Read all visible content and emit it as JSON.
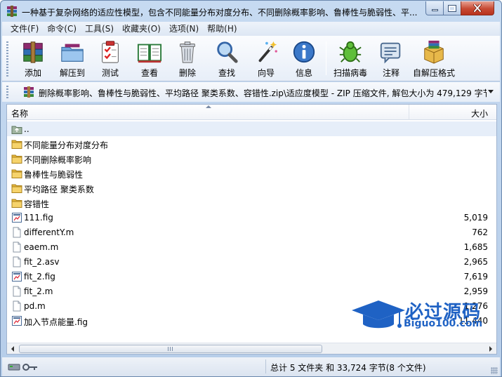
{
  "window": {
    "title": "一种基于复杂网络的适应性模型，包含不同能量分布对度分布、不同删除概率影响、鲁棒性与脆弱性、平..."
  },
  "menu": [
    {
      "label": "文件(F)"
    },
    {
      "label": "命令(C)"
    },
    {
      "label": "工具(S)"
    },
    {
      "label": "收藏夹(O)"
    },
    {
      "label": "选项(N)"
    },
    {
      "label": "帮助(H)"
    }
  ],
  "toolbar": {
    "add": "添加",
    "extract": "解压到",
    "test": "测试",
    "view": "查看",
    "delete": "删除",
    "find": "查找",
    "wizard": "向导",
    "info": "信息",
    "virus_scan": "扫描病毒",
    "comment": "注释",
    "sfx": "自解压格式"
  },
  "address": {
    "path": "删除概率影响、鲁棒性与脆弱性、平均路径 聚类系数、容错性.zip\\适应度模型 - ZIP 压缩文件, 解包大小为 479,129 字节"
  },
  "columns": {
    "name": "名称",
    "size": "大小"
  },
  "files": [
    {
      "name": "..",
      "size": "",
      "icon": "parent-folder-icon"
    },
    {
      "name": "不同能量分布对度分布",
      "size": "",
      "icon": "folder-icon"
    },
    {
      "name": "不同删除概率影响",
      "size": "",
      "icon": "folder-icon"
    },
    {
      "name": "鲁棒性与脆弱性",
      "size": "",
      "icon": "folder-icon"
    },
    {
      "name": "平均路径 聚类系数",
      "size": "",
      "icon": "folder-icon"
    },
    {
      "name": "容错性",
      "size": "",
      "icon": "folder-icon"
    },
    {
      "name": "111.fig",
      "size": "5,019",
      "icon": "fig-file-icon"
    },
    {
      "name": "differentY.m",
      "size": "762",
      "icon": "file-icon"
    },
    {
      "name": "eaem.m",
      "size": "1,685",
      "icon": "file-icon"
    },
    {
      "name": "fit_2.asv",
      "size": "2,965",
      "icon": "file-icon"
    },
    {
      "name": "fit_2.fig",
      "size": "7,619",
      "icon": "fig-file-icon"
    },
    {
      "name": "fit_2.m",
      "size": "2,959",
      "icon": "file-icon"
    },
    {
      "name": "pd.m",
      "size": "1,276",
      "icon": "file-icon"
    },
    {
      "name": "加入节点能量.fig",
      "size": "11,440",
      "icon": "fig-file-icon"
    }
  ],
  "watermark": {
    "brand": "必过源码",
    "url": "Biguo100.com"
  },
  "status": {
    "summary": "总计 5 文件夹 和 33,724 字节(8 个文件)"
  },
  "colors": {
    "accent": "#1f62c4",
    "folder": "#e8b93a",
    "close_button": "#c74a33"
  }
}
